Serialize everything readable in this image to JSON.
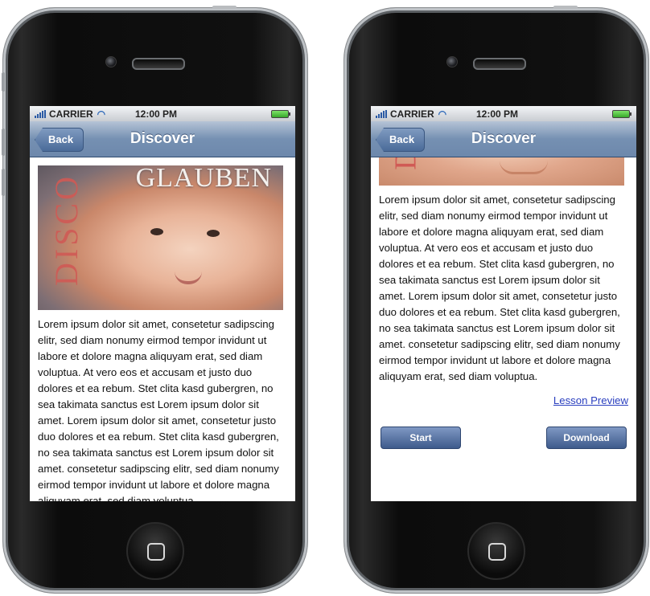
{
  "status_bar": {
    "carrier": "CARRIER",
    "time": "12:00 PM"
  },
  "nav": {
    "back_label": "Back",
    "title": "Discover"
  },
  "hero": {
    "title_text": "GLAUBEN",
    "side_text": "DISCO"
  },
  "body_text": "Lorem ipsum dolor sit amet, consetetur sadipscing elitr, sed diam nonumy eirmod tempor invidunt ut labore et dolore magna aliquyam erat, sed diam voluptua. At vero eos et accusam et justo duo dolores et ea rebum. Stet clita kasd gubergren, no sea takimata sanctus est Lorem ipsum dolor sit amet. Lorem ipsum dolor sit amet, consetetur  justo duo dolores et ea rebum. Stet clita kasd gubergren, no sea takimata sanctus est Lorem ipsum dolor sit amet. consetetur sadipscing elitr, sed diam nonumy eirmod tempor invidunt ut labore et dolore magna aliquyam erat, sed diam voluptua.",
  "lesson_preview_label": "Lesson Preview",
  "buttons": {
    "start": "Start",
    "download": "Download"
  },
  "colors": {
    "nav_bar": "#7590b2",
    "button": "#3e5b8c",
    "link": "#2a3fbf"
  },
  "icons": [
    "signal-icon",
    "wifi-icon",
    "battery-icon",
    "camera-icon",
    "speaker-icon",
    "home-button-icon"
  ]
}
